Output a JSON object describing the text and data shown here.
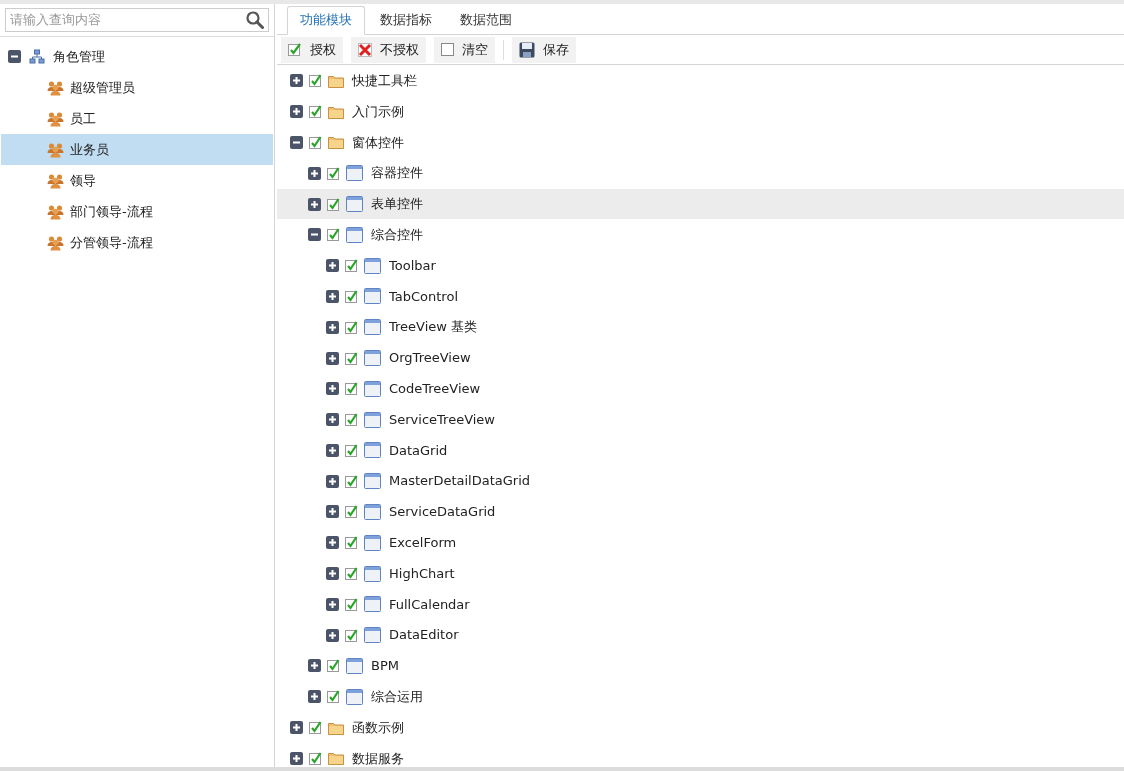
{
  "search": {
    "placeholder": "请输入查询内容"
  },
  "role_tree": {
    "label": "角色管理",
    "expanded": true,
    "children": [
      {
        "label": "超级管理员",
        "selected": false
      },
      {
        "label": "员工",
        "selected": false
      },
      {
        "label": "业务员",
        "selected": true
      },
      {
        "label": "领导",
        "selected": false
      },
      {
        "label": "部门领导-流程",
        "selected": false
      },
      {
        "label": "分管领导-流程",
        "selected": false
      }
    ]
  },
  "tabs": [
    {
      "label": "功能模块",
      "selected": true
    },
    {
      "label": "数据指标",
      "selected": false
    },
    {
      "label": "数据范围",
      "selected": false
    }
  ],
  "toolbar": [
    {
      "kind": "grant",
      "label": "授权"
    },
    {
      "kind": "revoke",
      "label": "不授权"
    },
    {
      "kind": "clear",
      "label": "清空"
    },
    {
      "kind": "save",
      "label": "保存"
    }
  ],
  "module_tree": [
    {
      "label": "快捷工具栏",
      "kind": "folder",
      "expanded": false,
      "checked": true,
      "highlighted": false
    },
    {
      "label": "入门示例",
      "kind": "folder",
      "expanded": false,
      "checked": true,
      "highlighted": false
    },
    {
      "label": "窗体控件",
      "kind": "folder",
      "expanded": true,
      "checked": true,
      "highlighted": false,
      "children": [
        {
          "label": "容器控件",
          "kind": "window",
          "expanded": false,
          "checked": true,
          "highlighted": false
        },
        {
          "label": "表单控件",
          "kind": "window",
          "expanded": false,
          "checked": true,
          "highlighted": true
        },
        {
          "label": "综合控件",
          "kind": "window",
          "expanded": true,
          "checked": true,
          "highlighted": false,
          "children": [
            {
              "label": "Toolbar",
              "kind": "window",
              "expanded": false,
              "checked": true,
              "highlighted": false
            },
            {
              "label": "TabControl",
              "kind": "window",
              "expanded": false,
              "checked": true,
              "highlighted": false
            },
            {
              "label": "TreeView 基类",
              "kind": "window",
              "expanded": false,
              "checked": true,
              "highlighted": false
            },
            {
              "label": "OrgTreeView",
              "kind": "window",
              "expanded": false,
              "checked": true,
              "highlighted": false
            },
            {
              "label": "CodeTreeView",
              "kind": "window",
              "expanded": false,
              "checked": true,
              "highlighted": false
            },
            {
              "label": "ServiceTreeView",
              "kind": "window",
              "expanded": false,
              "checked": true,
              "highlighted": false
            },
            {
              "label": "DataGrid",
              "kind": "window",
              "expanded": false,
              "checked": true,
              "highlighted": false
            },
            {
              "label": "MasterDetailDataGrid",
              "kind": "window",
              "expanded": false,
              "checked": true,
              "highlighted": false
            },
            {
              "label": "ServiceDataGrid",
              "kind": "window",
              "expanded": false,
              "checked": true,
              "highlighted": false
            },
            {
              "label": "ExcelForm",
              "kind": "window",
              "expanded": false,
              "checked": true,
              "highlighted": false
            },
            {
              "label": "HighChart",
              "kind": "window",
              "expanded": false,
              "checked": true,
              "highlighted": false
            },
            {
              "label": "FullCalendar",
              "kind": "window",
              "expanded": false,
              "checked": true,
              "highlighted": false
            },
            {
              "label": "DataEditor",
              "kind": "window",
              "expanded": false,
              "checked": true,
              "highlighted": false
            }
          ]
        },
        {
          "label": "BPM",
          "kind": "window",
          "expanded": false,
          "checked": true,
          "highlighted": false
        },
        {
          "label": "综合运用",
          "kind": "window",
          "expanded": false,
          "checked": true,
          "highlighted": false
        }
      ]
    },
    {
      "label": "函数示例",
      "kind": "folder",
      "expanded": false,
      "checked": true,
      "highlighted": false
    },
    {
      "label": "数据服务",
      "kind": "folder",
      "expanded": false,
      "checked": true,
      "highlighted": false
    }
  ]
}
